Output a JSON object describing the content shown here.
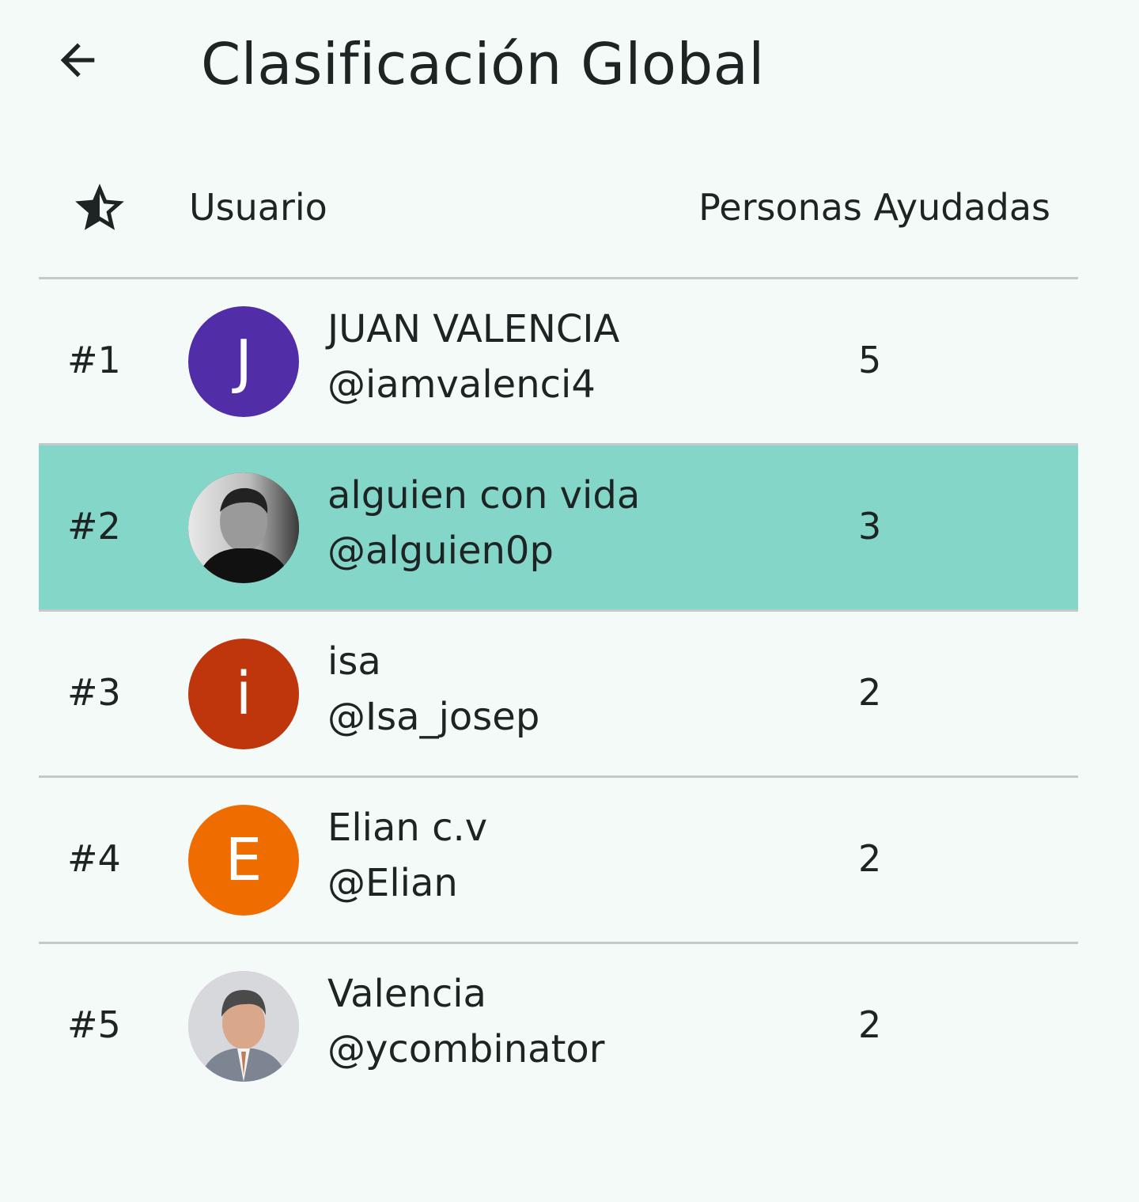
{
  "header": {
    "title": "Clasificación Global",
    "back_icon": "arrow-left-icon"
  },
  "table": {
    "rank_column_icon": "star-icon",
    "user_column_label": "Usuario",
    "count_column_label": "Personas Ayudadas"
  },
  "rows": [
    {
      "rank": "#1",
      "name": "JUAN VALENCIA",
      "handle": "@iamvalenci4",
      "count": "5",
      "avatar_letter": "J",
      "avatar_color": "#512da8",
      "highlighted": false
    },
    {
      "rank": "#2",
      "name": "alguien con vida",
      "handle": "@alguien0p",
      "count": "3",
      "avatar_letter": "",
      "avatar_color": "#2a2a2a",
      "highlighted": true
    },
    {
      "rank": "#3",
      "name": "isa",
      "handle": "@Isa_josep",
      "count": "2",
      "avatar_letter": "i",
      "avatar_color": "#bf360c",
      "highlighted": false
    },
    {
      "rank": "#4",
      "name": "Elian c.v",
      "handle": "@Elian",
      "count": "2",
      "avatar_letter": "E",
      "avatar_color": "#ef6c00",
      "highlighted": false
    },
    {
      "rank": "#5",
      "name": "Valencia",
      "handle": "@ycombinator",
      "count": "2",
      "avatar_letter": "",
      "avatar_color": "#c9ccd0",
      "highlighted": false
    }
  ],
  "colors": {
    "background": "#f4faf8",
    "highlight_row": "#84d6c9",
    "divider": "#c3c9c8",
    "text": "#1d2423"
  }
}
